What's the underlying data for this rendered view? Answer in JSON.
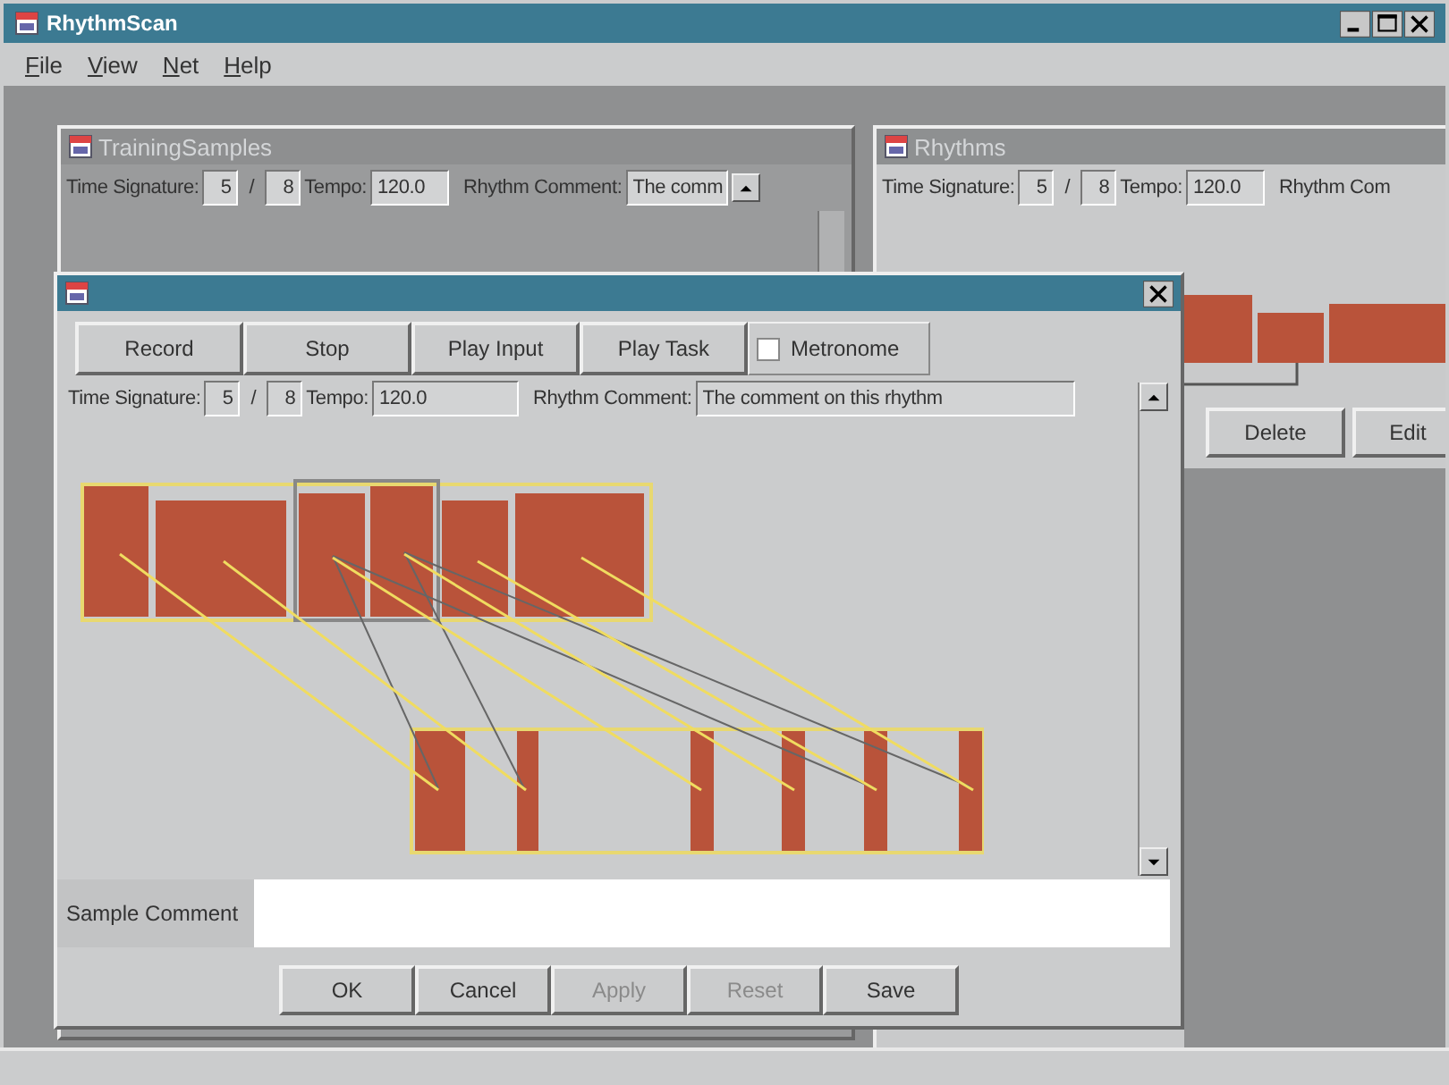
{
  "window": {
    "title": "RhythmScan"
  },
  "menu": [
    {
      "label": "File"
    },
    {
      "label": "View"
    },
    {
      "label": "Net"
    },
    {
      "label": "Help"
    }
  ],
  "frames": [
    {
      "kind": "training",
      "title": "TrainingSamples",
      "active": false,
      "time_signature_label": "Time Signature:",
      "numerator": "5",
      "separator": "/",
      "denominator": "8",
      "tempo_label": "Tempo:",
      "tempo": "120.0",
      "comment_label": "Rhythm Comment:",
      "comment": "The comm"
    },
    {
      "kind": "rhythms",
      "title": "Rhythms",
      "active": false,
      "time_signature_label": "Time Signature:",
      "numerator": "5",
      "separator": "/",
      "denominator": "8",
      "tempo_label": "Tempo:",
      "tempo": "120.0",
      "comment_label": "Rhythm Com",
      "buttons": [
        "Delete",
        "Edit"
      ]
    }
  ],
  "dialog": {
    "active": true,
    "buttons": [
      "Record",
      "Stop",
      "Play Input",
      "Play Task"
    ],
    "metronome": {
      "label": "Metronome",
      "checked": false
    },
    "time_signature_label": "Time Signature:",
    "numerator": "5",
    "separator": "/",
    "denominator": "8",
    "tempo_label": "Tempo:",
    "tempo": "120.0",
    "comment_label": "Rhythm Comment:",
    "comment": "The comment on this rhythm",
    "sample_comment_label": "Sample Comment",
    "actions": [
      {
        "label": "OK",
        "disabled": false
      },
      {
        "label": "Cancel",
        "disabled": false
      },
      {
        "label": "Apply",
        "disabled": true
      },
      {
        "label": "Reset",
        "disabled": true
      },
      {
        "label": "Save",
        "disabled": false
      }
    ]
  }
}
